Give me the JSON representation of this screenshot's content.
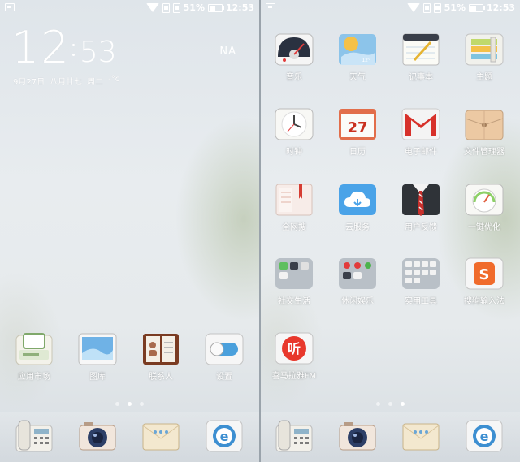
{
  "status": {
    "battery": "51%",
    "time": "12:53"
  },
  "clock": {
    "hour": "12",
    "minute": "53",
    "date": "9月27日",
    "lunar": "八月廿七",
    "weekday": "周二",
    "temp": "-°c",
    "weather": "NA"
  },
  "left_screen": {
    "apps": [
      {
        "label": "应用市场",
        "icon": "app-market-icon"
      },
      {
        "label": "图库",
        "icon": "gallery-icon"
      },
      {
        "label": "联系人",
        "icon": "contacts-icon"
      },
      {
        "label": "设置",
        "icon": "settings-toggle-icon"
      }
    ]
  },
  "right_screen": {
    "apps": [
      {
        "label": "音乐",
        "icon": "music-icon"
      },
      {
        "label": "天气",
        "icon": "weather-icon"
      },
      {
        "label": "记事本",
        "icon": "notepad-icon"
      },
      {
        "label": "主题",
        "icon": "theme-icon"
      },
      {
        "label": "时钟",
        "icon": "clock-icon"
      },
      {
        "label": "日历",
        "icon": "calendar-icon",
        "day": "27"
      },
      {
        "label": "电子邮件",
        "icon": "email-icon"
      },
      {
        "label": "文件管理器",
        "icon": "file-manager-icon"
      },
      {
        "label": "全网搜",
        "icon": "search-doc-icon"
      },
      {
        "label": "云服务",
        "icon": "cloud-icon"
      },
      {
        "label": "用户反馈",
        "icon": "feedback-icon"
      },
      {
        "label": "一键优化",
        "icon": "optimize-icon"
      },
      {
        "label": "社交生活",
        "icon": "folder-icon"
      },
      {
        "label": "休闲娱乐",
        "icon": "folder-icon"
      },
      {
        "label": "实用工具",
        "icon": "folder-icon"
      },
      {
        "label": "搜狗输入法",
        "icon": "sogou-icon"
      },
      {
        "label": "喜马拉雅FM",
        "icon": "ximalaya-icon"
      }
    ]
  },
  "pages": {
    "left_active": 1,
    "right_active": 2,
    "count": 3
  },
  "dock": [
    {
      "icon": "phone-icon"
    },
    {
      "icon": "camera-icon"
    },
    {
      "icon": "messages-icon"
    },
    {
      "icon": "browser-icon"
    }
  ]
}
